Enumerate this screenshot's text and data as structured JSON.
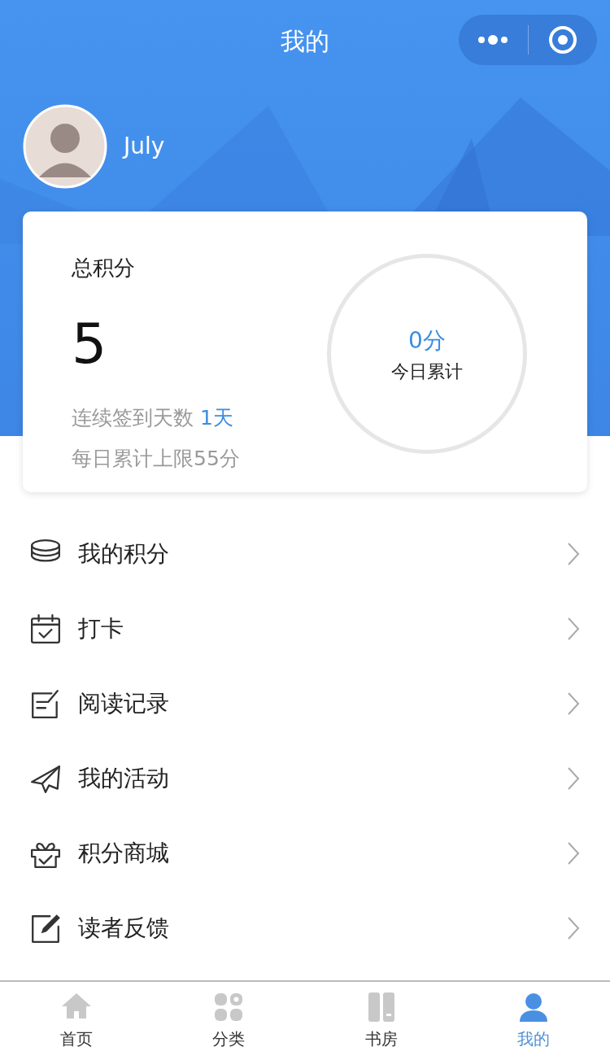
{
  "header": {
    "title": "我的",
    "user_name": "July"
  },
  "points_card": {
    "title": "总积分",
    "total": "5",
    "streak_label": "连续签到天数",
    "streak_value": "1天",
    "daily_limit": "每日累计上限55分",
    "today_points": "0分",
    "today_label": "今日累计"
  },
  "menu": [
    {
      "kind": "coins",
      "label": "我的积分"
    },
    {
      "kind": "calendar",
      "label": "打卡"
    },
    {
      "kind": "note",
      "label": "阅读记录"
    },
    {
      "kind": "plane",
      "label": "我的活动"
    },
    {
      "kind": "gift",
      "label": "积分商城"
    },
    {
      "kind": "edit",
      "label": "读者反馈"
    }
  ],
  "tab_bar": [
    {
      "kind": "home",
      "label": "首页",
      "selected": false
    },
    {
      "kind": "grid",
      "label": "分类",
      "selected": false
    },
    {
      "kind": "books",
      "label": "书房",
      "selected": false
    },
    {
      "kind": "user",
      "label": "我的",
      "selected": true
    }
  ]
}
